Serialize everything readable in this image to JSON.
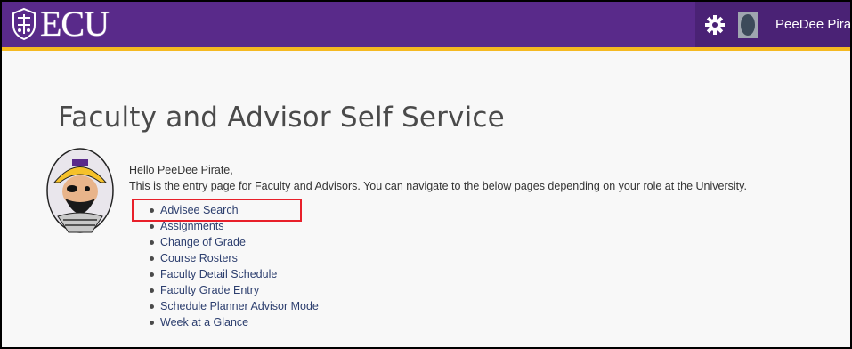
{
  "header": {
    "logo_text": "ECU",
    "user_name": "PeeDee Pirate",
    "colors": {
      "bar": "#592a8a",
      "accent": "#f5b921"
    }
  },
  "main": {
    "title": "Faculty and Advisor Self Service",
    "greeting": "Hello PeeDee Pirate,",
    "intro": "This is the entry page for Faculty and Advisors. You can navigate to the below pages depending on your role at the University.",
    "links": [
      "Advisee Search",
      "Assignments",
      "Change of Grade",
      "Course Rosters",
      "Faculty Detail Schedule",
      "Faculty Grade Entry",
      "Schedule Planner Advisor Mode",
      "Week at a Glance"
    ]
  },
  "icons": {
    "settings": "gear-icon",
    "avatar": "user-avatar-icon",
    "mascot": "pirate-mascot-image",
    "emblem": "ecu-shield-emblem"
  },
  "annotation": {
    "highlight_color": "#e8202a"
  }
}
